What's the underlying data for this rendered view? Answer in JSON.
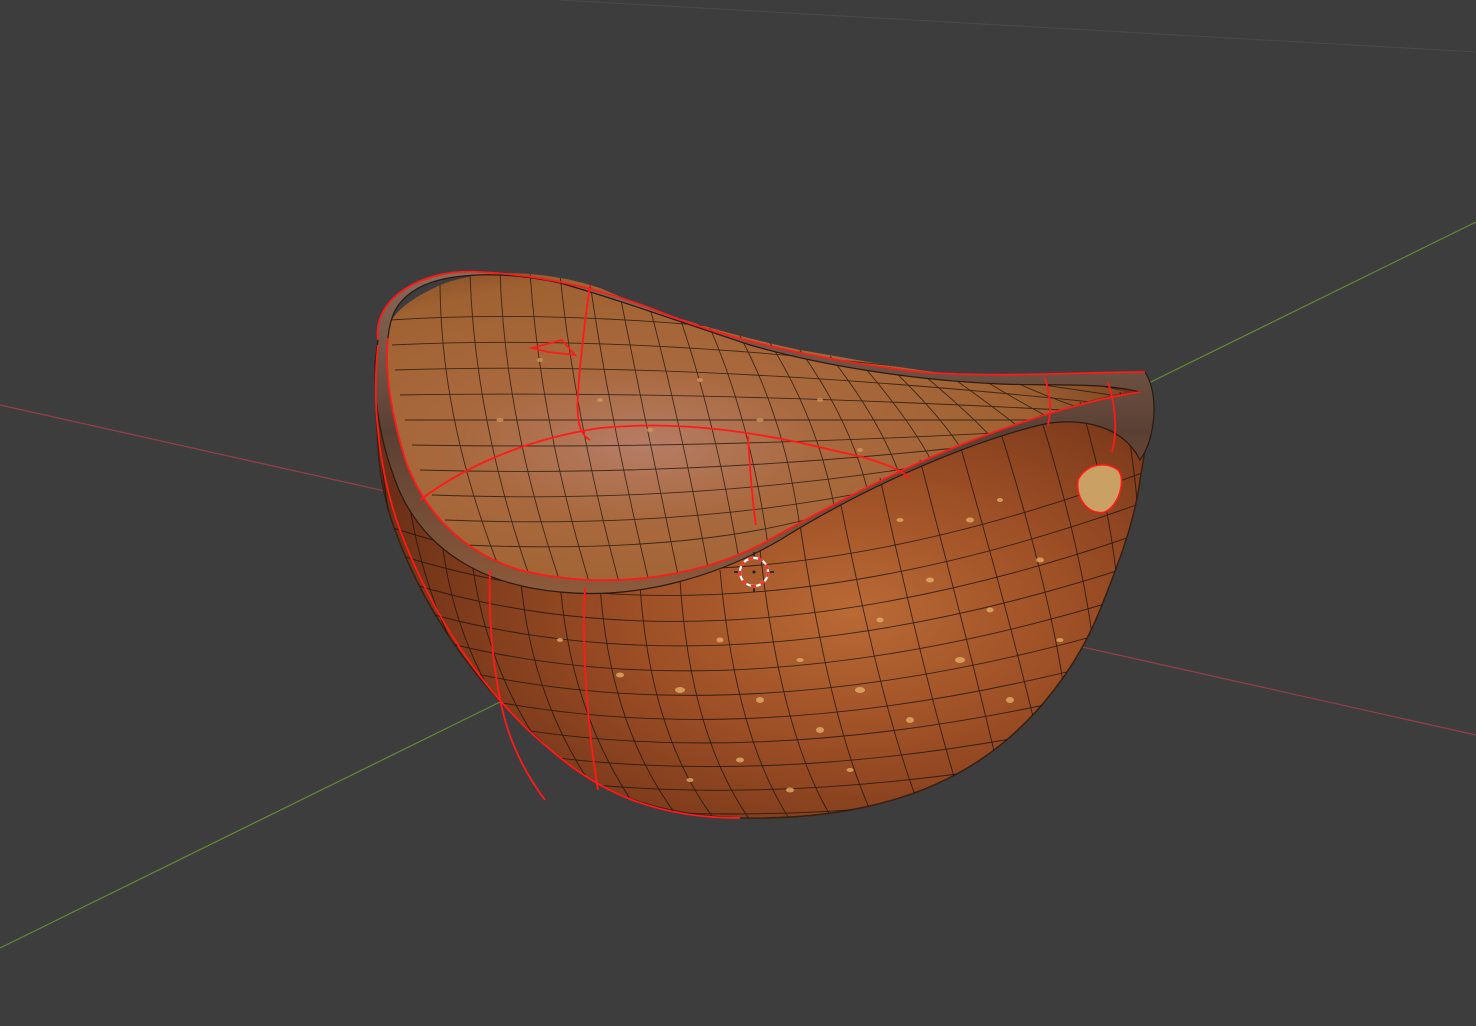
{
  "viewport": {
    "background_color": "#3d3d3d",
    "axis_x_color": "#b0424f",
    "axis_y_color": "#6f9a3a",
    "seam_color": "#ff1a1a",
    "wire_color": "#1b120c",
    "cursor_color": "#ff2a2a",
    "mesh_object": "bowl-mesh",
    "cursor_icon": "3d-cursor-icon"
  }
}
